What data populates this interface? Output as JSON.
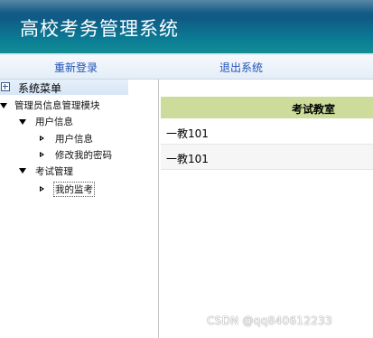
{
  "header": {
    "title": "高校考务管理系统"
  },
  "topnav": {
    "relogin": "重新登录",
    "logout": "退出系统"
  },
  "sidebar": {
    "menu_title": "系统菜单",
    "module": "管理员信息管理模块",
    "groups": [
      {
        "label": "用户信息",
        "items": [
          "用户信息",
          "修改我的密码"
        ]
      },
      {
        "label": "考试管理",
        "items": [
          "我的监考"
        ]
      }
    ],
    "selected_item": "我的监考"
  },
  "table": {
    "columns": [
      "考试教室"
    ],
    "rows": [
      [
        "一教101"
      ],
      [
        "一教101"
      ]
    ]
  },
  "watermark": "CSDN @qq840612233",
  "colors": {
    "header": "#0f5b86",
    "nav_link": "#1f53b8",
    "table_header": "#cddb9b"
  }
}
